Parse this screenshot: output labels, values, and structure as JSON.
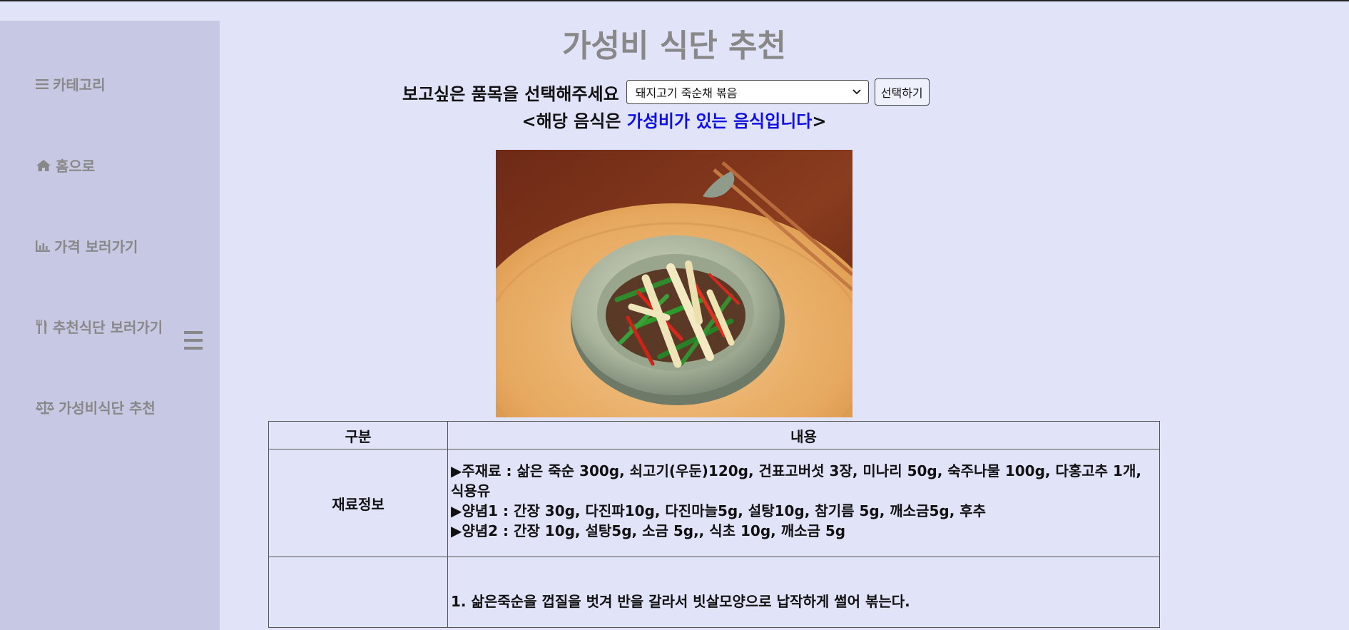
{
  "sidebar": {
    "items": [
      {
        "icon": "list-icon",
        "label": "카테고리"
      },
      {
        "icon": "home-icon",
        "label": "홈으로"
      },
      {
        "icon": "chart-icon",
        "label": "가격 보러가기"
      },
      {
        "icon": "utensils-icon",
        "label": "추천식단 보러가기"
      },
      {
        "icon": "scale-icon",
        "label": "가성비식단 추천"
      }
    ]
  },
  "header": {
    "title": "가성비 식단 추천"
  },
  "selector": {
    "label": "보고싶은 품목을 선택해주세요",
    "selected": "돼지고기 죽순채 볶음",
    "button_label": "선택하기"
  },
  "notice": {
    "prefix": "<해당 음식은 ",
    "highlight": "가성비가 있는 음식입니다",
    "suffix": ">"
  },
  "table": {
    "headers": [
      "구분",
      "내용"
    ],
    "rows": [
      {
        "label": "재료정보",
        "lines": [
          "▶주재료 : 삶은 죽순 300g, 쇠고기(우둔)120g, 건표고버섯 3장, 미나리 50g, 숙주나물 100g, 다홍고추 1개, 식용유",
          "▶양념1 : 간장 30g, 다진파10g, 다진마늘5g, 설탕10g, 참기름 5g, 깨소금5g, 후추",
          "▶양념2 : 간장 10g, 설탕5g, 소금 5g,, 식초 10g, 깨소금 5g"
        ]
      },
      {
        "label": "",
        "lines": [
          "1. 삶은죽순을 껍질을 벗겨 반을 갈라서 빗살모양으로 납작하게 썰어 볶는다."
        ]
      }
    ]
  },
  "colors": {
    "background": "#e1e3f8",
    "sidebar": "#c7c8e3",
    "highlight": "#1010e0",
    "muted": "#888888"
  }
}
